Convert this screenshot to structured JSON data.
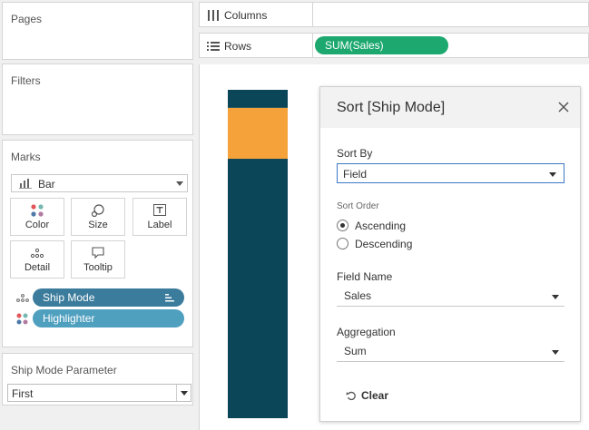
{
  "left_pane": {
    "pages_title": "Pages",
    "filters_title": "Filters",
    "marks": {
      "title": "Marks",
      "mark_type": "Bar",
      "buttons": {
        "color": "Color",
        "size": "Size",
        "label": "Label",
        "detail": "Detail",
        "tooltip": "Tooltip"
      },
      "pills": [
        {
          "label": "Ship Mode",
          "icon": "detail-dots-icon",
          "has_sort": true
        },
        {
          "label": "Highlighter",
          "icon": "color-dots-icon"
        }
      ]
    },
    "parameter": {
      "title": "Ship Mode Parameter",
      "value": "First"
    }
  },
  "shelves": {
    "columns_label": "Columns",
    "rows_label": "Rows",
    "rows_pill": "SUM(Sales)"
  },
  "viz": {
    "colors": {
      "dark": "#0b4558",
      "highlight": "#f5a23a"
    },
    "stack_segments_fraction": [
      0.055,
      0.155,
      0.79
    ]
  },
  "sort_dialog": {
    "title": "Sort [Ship Mode]",
    "sort_by_label": "Sort By",
    "sort_by_value": "Field",
    "sort_order_label": "Sort Order",
    "ascending_label": "Ascending",
    "descending_label": "Descending",
    "selected_order": "ascending",
    "field_name_label": "Field Name",
    "field_name_value": "Sales",
    "aggregation_label": "Aggregation",
    "aggregation_value": "Sum",
    "clear_label": "Clear"
  },
  "colors": {
    "pill_dark": "#3b7b9b",
    "pill_light": "#4f9fbf",
    "measure_green": "#1ca86f",
    "focus_blue": "#3b79c6"
  }
}
